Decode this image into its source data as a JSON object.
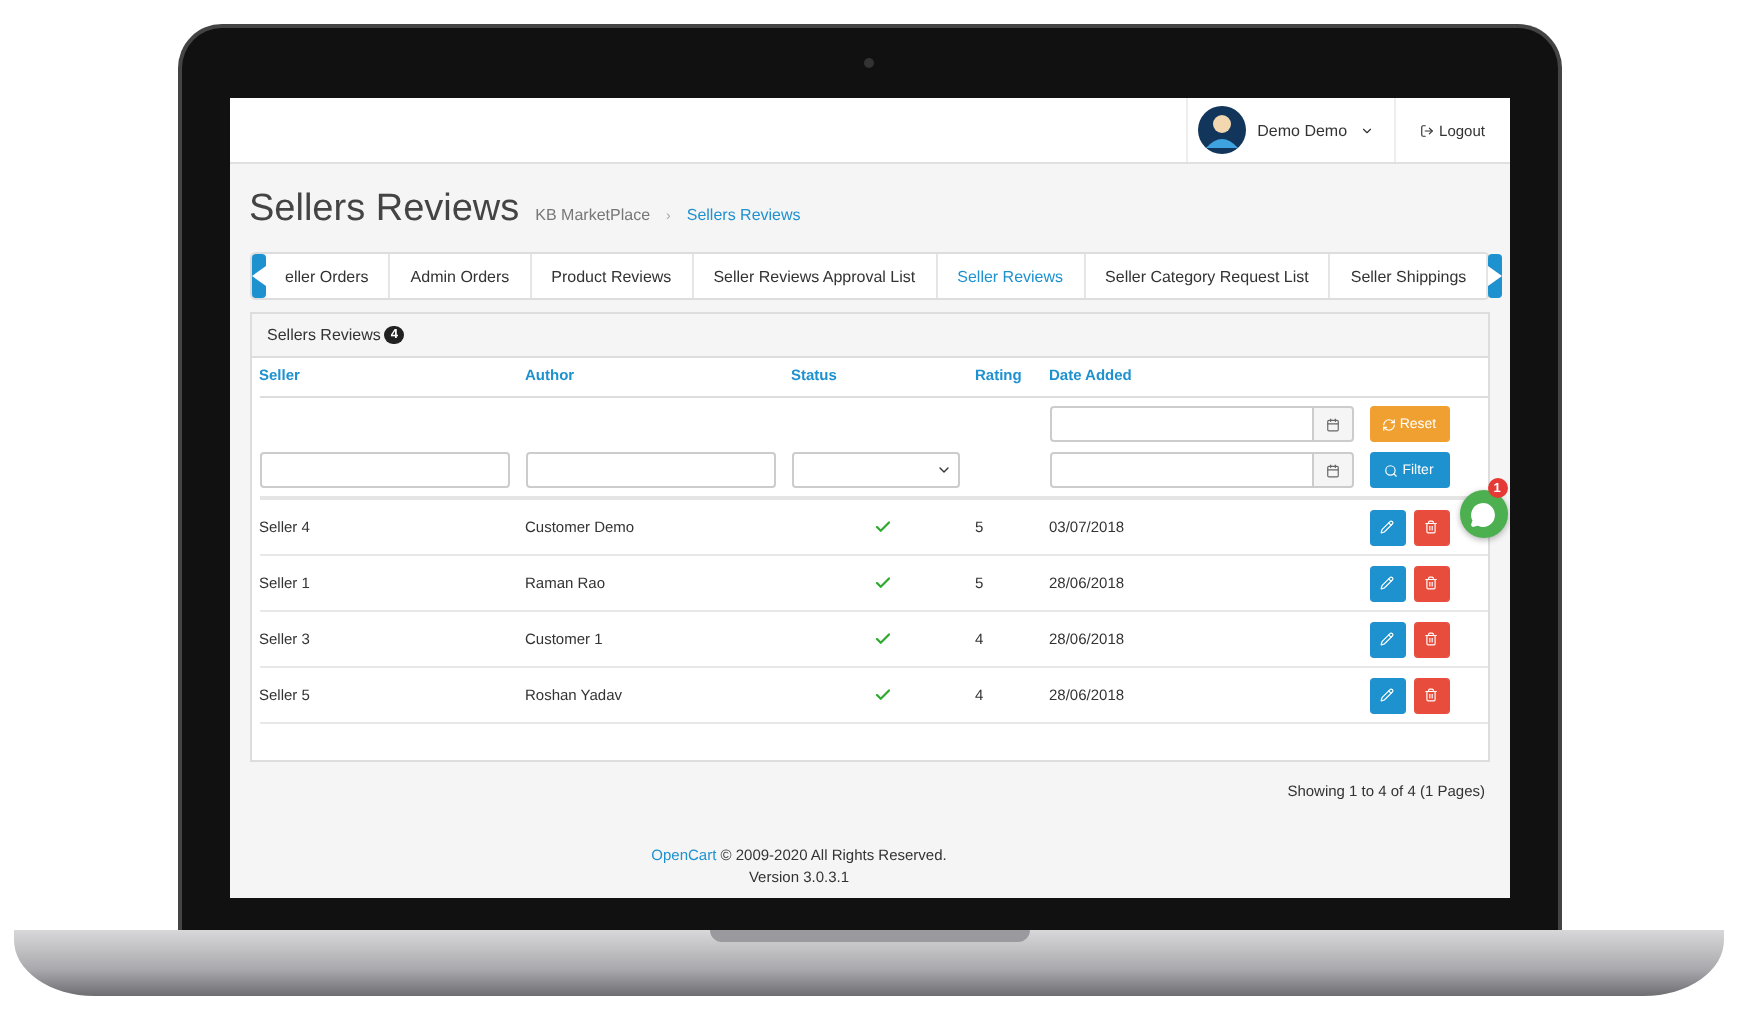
{
  "header": {
    "user_name": "Demo Demo",
    "logout": "Logout"
  },
  "page": {
    "title": "Sellers Reviews",
    "separator": "›",
    "breadcrumbs": [
      {
        "label": "KB MarketPlace",
        "selected": false
      },
      {
        "label": "Sellers Reviews",
        "selected": true
      }
    ]
  },
  "tabs": [
    {
      "label": "eller Orders",
      "selected": false
    },
    {
      "label": "Admin Orders",
      "selected": false
    },
    {
      "label": "Product Reviews",
      "selected": false
    },
    {
      "label": "Seller Reviews Approval List",
      "selected": false
    },
    {
      "label": "Seller Reviews",
      "selected": true
    },
    {
      "label": "Seller Category Request List",
      "selected": false
    },
    {
      "label": "Seller Shippings",
      "selected": false
    }
  ],
  "panel": {
    "title": "Sellers Reviews",
    "count": "4"
  },
  "table": {
    "columns": [
      "Seller",
      "Author",
      "Status",
      "Rating",
      "Date Added"
    ],
    "filter_buttons": [
      "Reset",
      "Filter"
    ],
    "rows": [
      {
        "seller": "Seller 4",
        "author": "Customer Demo",
        "enabled": true,
        "rating": "5",
        "date": "03/07/2018"
      },
      {
        "seller": "Seller 1",
        "author": "Raman Rao",
        "enabled": true,
        "rating": "5",
        "date": "28/06/2018"
      },
      {
        "seller": "Seller 3",
        "author": "Customer 1",
        "enabled": true,
        "rating": "4",
        "date": "28/06/2018"
      },
      {
        "seller": "Seller 5",
        "author": "Roshan Yadav",
        "enabled": true,
        "rating": "4",
        "date": "28/06/2018"
      }
    ]
  },
  "pagination": "Showing 1 to 4 of 4 (1 Pages)",
  "footer": {
    "link": "OpenCart",
    "copyright": "© 2009-2020 All Rights Reserved.",
    "version": "Version 3.0.3.1"
  },
  "chat": {
    "badge": "1"
  }
}
